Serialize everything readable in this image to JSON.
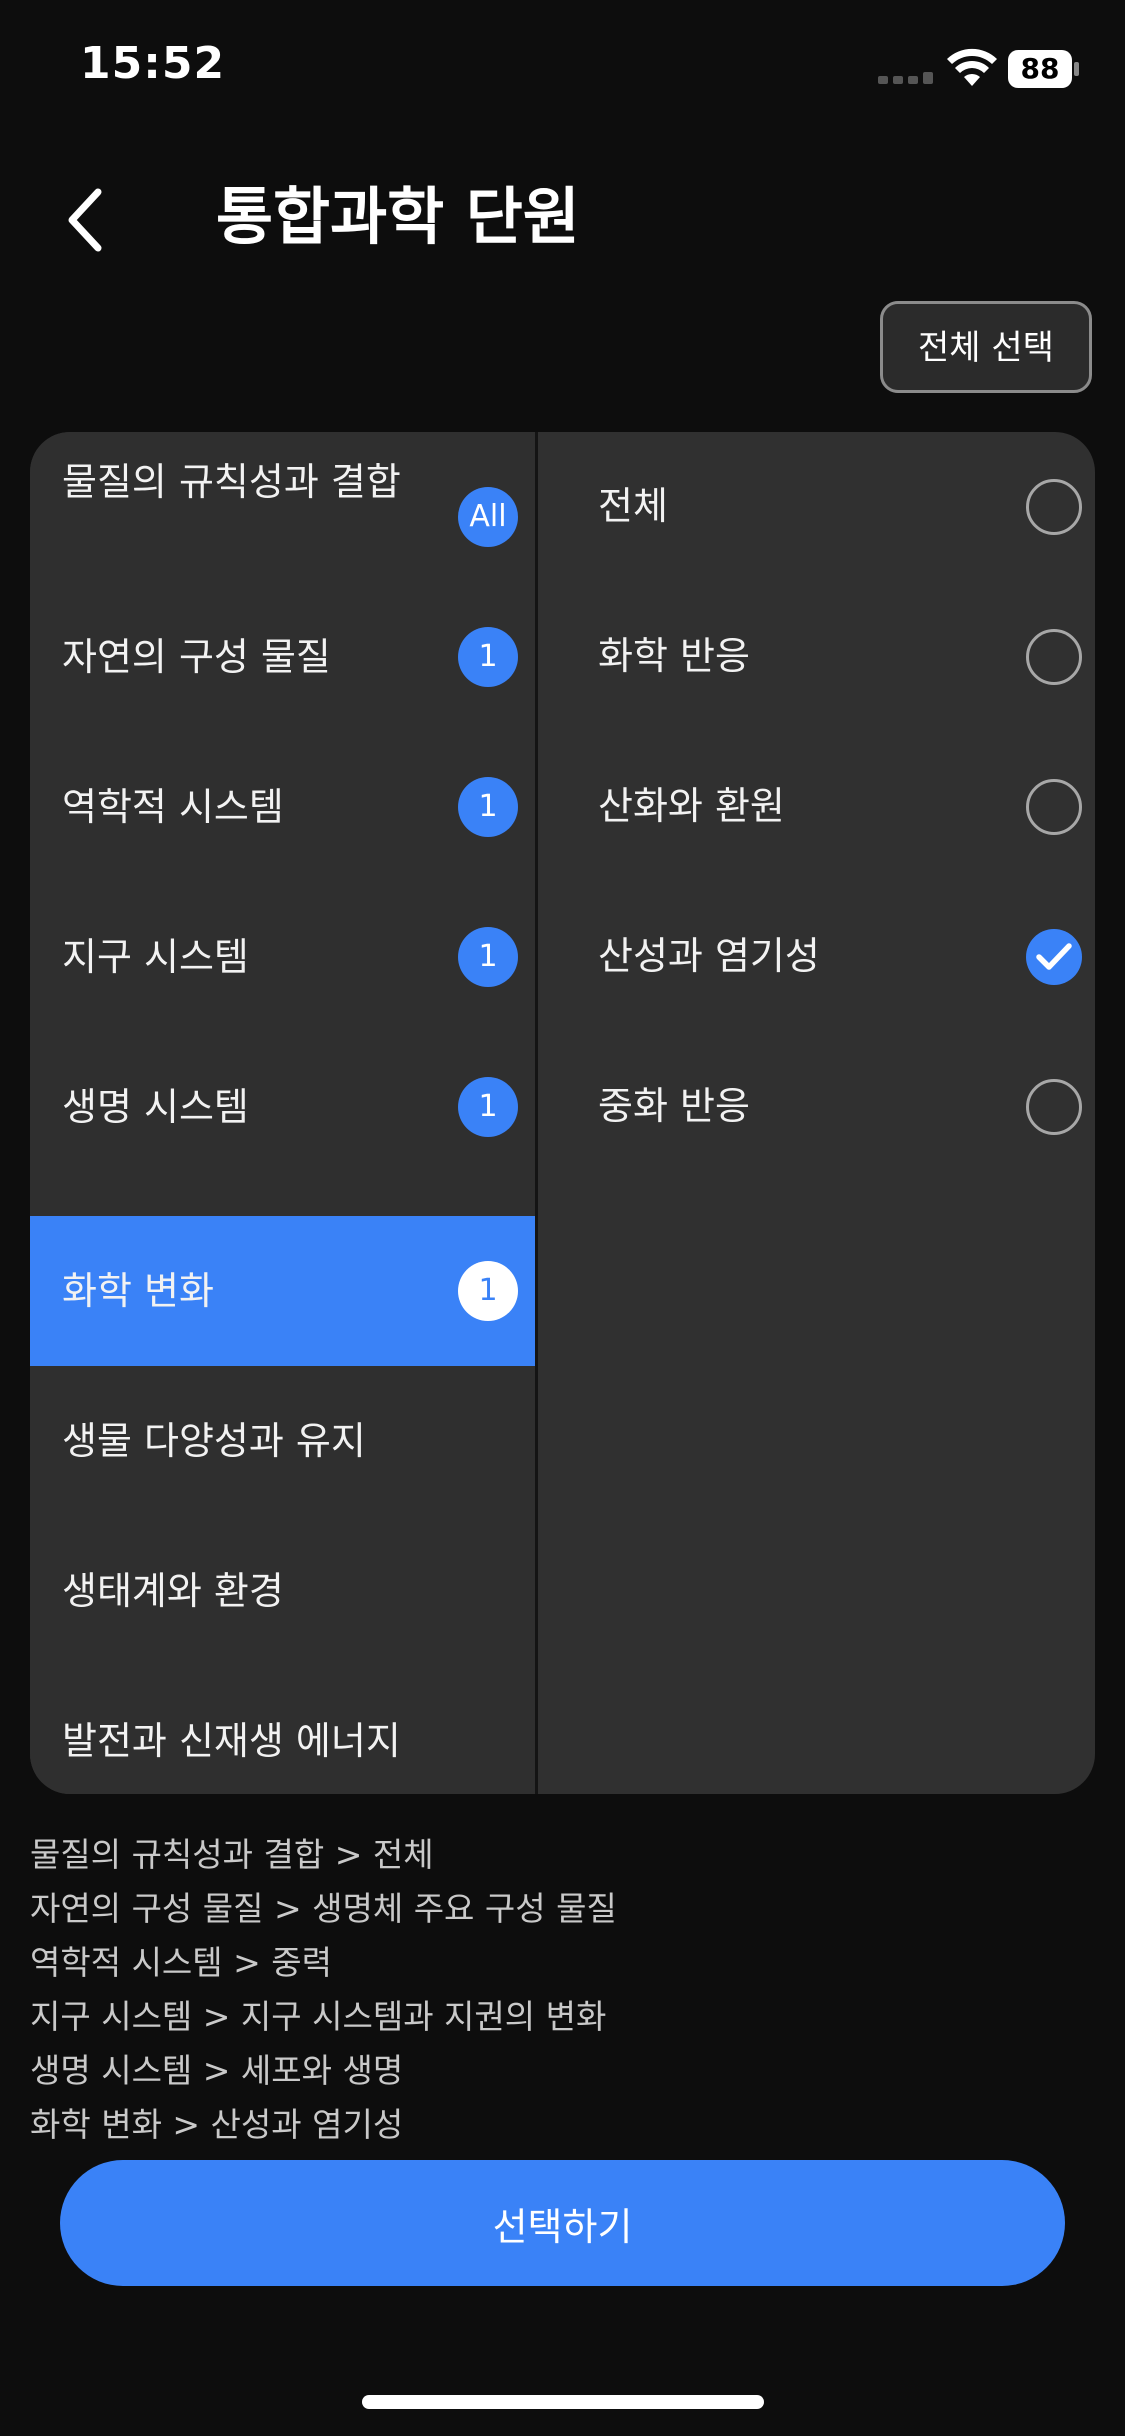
{
  "status_bar": {
    "time": "15:52",
    "battery_level": "88",
    "signal_icon": "cellular-signal-icon",
    "wifi_icon": "wifi-icon",
    "battery_icon": "battery-icon"
  },
  "header": {
    "back_icon": "chevron-left-icon",
    "title": "통합과학 단원"
  },
  "select_all_label": "전체 선택",
  "units": [
    {
      "label": "물질의 규칙성과 결합",
      "badge": "All",
      "selected": false
    },
    {
      "label": "자연의 구성 물질",
      "badge": "1",
      "selected": false
    },
    {
      "label": "역학적 시스템",
      "badge": "1",
      "selected": false
    },
    {
      "label": "지구 시스템",
      "badge": "1",
      "selected": false
    },
    {
      "label": "생명 시스템",
      "badge": "1",
      "selected": false
    },
    {
      "label": "화학 변화",
      "badge": "1",
      "selected": true
    },
    {
      "label": "생물 다양성과 유지",
      "badge": "",
      "selected": false
    },
    {
      "label": "생태계와 환경",
      "badge": "",
      "selected": false
    },
    {
      "label": "발전과 신재생 에너지",
      "badge": "",
      "selected": false
    }
  ],
  "sub_units": [
    {
      "label": "전체",
      "checked": false
    },
    {
      "label": "화학 반응",
      "checked": false
    },
    {
      "label": "산화와 환원",
      "checked": false
    },
    {
      "label": "산성과 염기성",
      "checked": true
    },
    {
      "label": "중화 반응",
      "checked": false
    }
  ],
  "summary": [
    "물질의 규칙성과 결합 > 전체",
    "자연의 구성 물질 > 생명체 주요 구성 물질",
    "역학적 시스템 > 중력",
    "지구 시스템 > 지구 시스템과 지권의 변화",
    "생명 시스템 > 세포와 생명",
    "화학 변화 > 산성과 염기성"
  ],
  "confirm_label": "선택하기",
  "colors": {
    "accent": "#3a82f7",
    "background": "#0d0d0d",
    "panel": "#303030"
  }
}
